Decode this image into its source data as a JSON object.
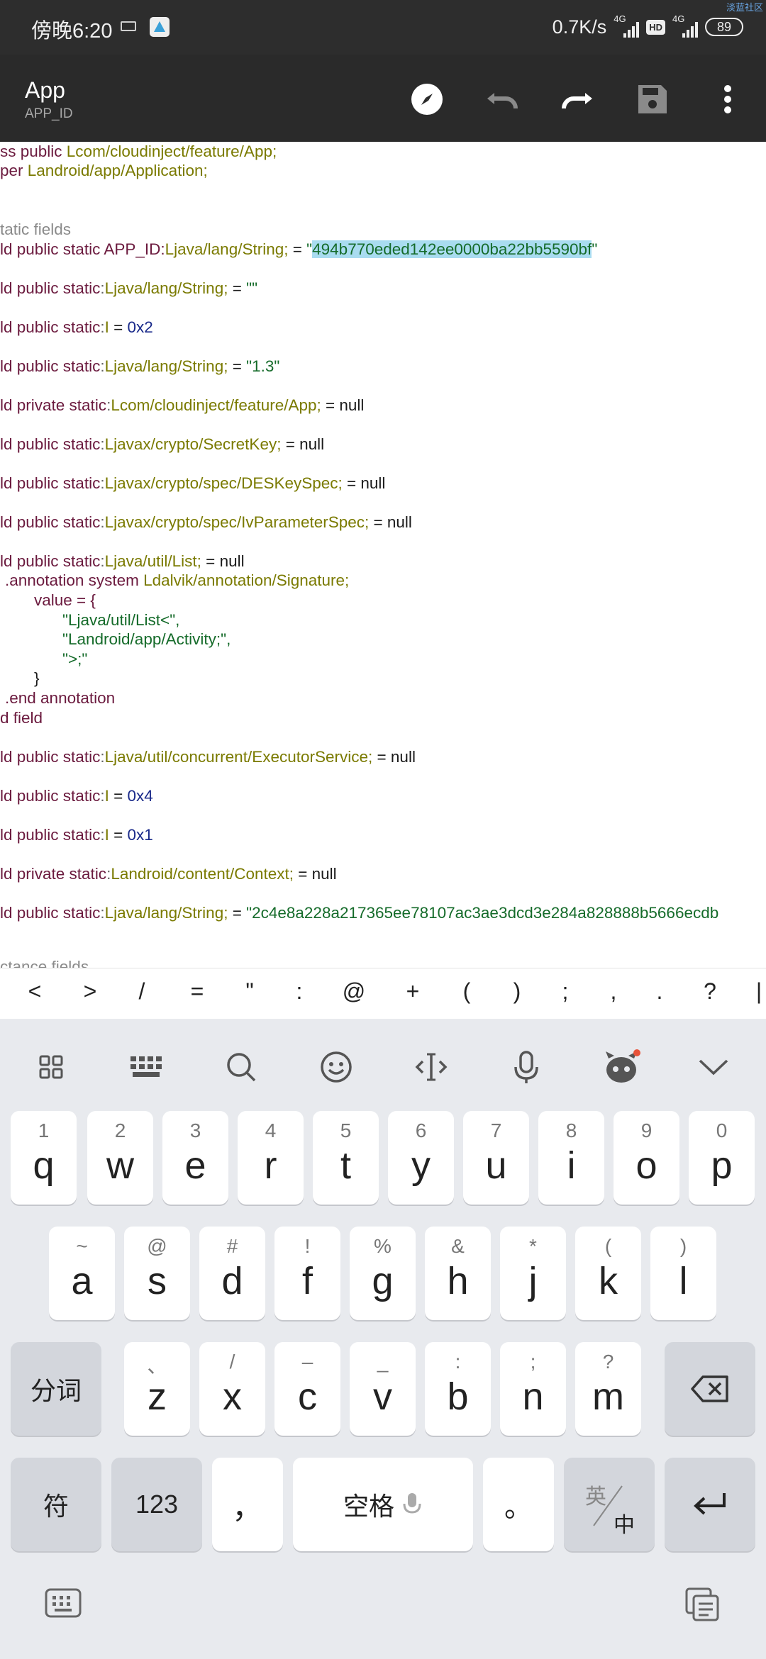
{
  "status_bar": {
    "time": "傍晚6:20",
    "net_speed": "0.7K/s",
    "net_label_1": "4G",
    "net_label_2": "4G",
    "hd": "HD",
    "battery": "89",
    "watermark": "淡蓝社区"
  },
  "app_bar": {
    "title": "App",
    "subtitle": "APP_ID",
    "actions": [
      "compass-icon",
      "undo-icon",
      "redo-icon",
      "save-icon",
      "more-vert-icon"
    ]
  },
  "code": {
    "l01": "ss public ",
    "l01b": "Lcom/cloudinject/feature/App;",
    "l02": "per ",
    "l02b": "Landroid/app/Application;",
    "l03": "tatic fields",
    "l04a": "ld public static APP_ID:",
    "l04b": "Ljava/lang/String;",
    "l04c": " = ",
    "l04d": "\"",
    "l04e": "494b770eded142ee0000ba22bb5590bf",
    "l04f": "\"",
    "l05a": "ld public static",
    "l05b": ":",
    "l05c": "Ljava/lang/String;",
    "l05d": " = ",
    "l05e": "\"\"",
    "l06a": "ld public static",
    "l06b": ":",
    "l06c": "I",
    "l06d": " = ",
    "l06e": "0x2",
    "l07a": "ld public static",
    "l07b": ":",
    "l07c": "Ljava/lang/String;",
    "l07d": " = ",
    "l07e": "\"1.3\"",
    "l08a": "ld private static",
    "l08b": ":",
    "l08c": "Lcom/cloudinject/feature/App;",
    "l08d": " = null",
    "l09a": "ld public static",
    "l09b": ":",
    "l09c": "Ljavax/crypto/SecretKey;",
    "l09d": " = null",
    "l10a": "ld public static",
    "l10b": ":",
    "l10c": "Ljavax/crypto/spec/DESKeySpec;",
    "l10d": " = null",
    "l11a": "ld public static",
    "l11b": ":",
    "l11c": "Ljavax/crypto/spec/IvParameterSpec;",
    "l11d": " = null",
    "l12a": "ld public static",
    "l12b": ":",
    "l12c": "Ljava/util/List;",
    "l12d": " = null",
    "l13a": ".annotation system ",
    "l13b": "Ldalvik/annotation/Signature;",
    "l14": "value = {",
    "l15": "\"Ljava/util/List<\",",
    "l16": "\"Landroid/app/Activity;\",",
    "l17": "\">;\"",
    "l18": "}",
    "l19": ".end annotation",
    "l20": "d field",
    "l21a": "ld public static",
    "l21b": ":",
    "l21c": "Ljava/util/concurrent/ExecutorService;",
    "l21d": " = null",
    "l22a": "ld public static",
    "l22b": ":",
    "l22c": "I",
    "l22d": " = ",
    "l22e": "0x4",
    "l23a": "ld public static",
    "l23b": ":",
    "l23c": "I",
    "l23d": " = ",
    "l23e": "0x1",
    "l24a": "ld private static",
    "l24b": ":",
    "l24c": "Landroid/content/Context;",
    "l24d": " = null",
    "l25a": "ld public static",
    "l25b": ":",
    "l25c": "Ljava/lang/String;",
    "l25d": " = ",
    "l25e": "\"2c4e8a228a217365ee78107ac3ae3dcd3e284a828888b5666ecdb",
    "l26": "ctance fields"
  },
  "symbols": [
    "<",
    ">",
    "/",
    "=",
    "\"",
    ":",
    "@",
    "+",
    "(",
    ")",
    ";",
    ",",
    ".",
    "?",
    "|"
  ],
  "keyboard": {
    "tools": [
      "apps-grid-icon",
      "keyboard-icon",
      "search-icon",
      "emoji-icon",
      "cursor-icon",
      "mic-icon",
      "mascot-icon",
      "collapse-icon"
    ],
    "row1": [
      {
        "hint": "1",
        "key": "q"
      },
      {
        "hint": "2",
        "key": "w"
      },
      {
        "hint": "3",
        "key": "e"
      },
      {
        "hint": "4",
        "key": "r"
      },
      {
        "hint": "5",
        "key": "t"
      },
      {
        "hint": "6",
        "key": "y"
      },
      {
        "hint": "7",
        "key": "u"
      },
      {
        "hint": "8",
        "key": "i"
      },
      {
        "hint": "9",
        "key": "o"
      },
      {
        "hint": "0",
        "key": "p"
      }
    ],
    "row2": [
      {
        "hint": "~",
        "key": "a"
      },
      {
        "hint": "@",
        "key": "s"
      },
      {
        "hint": "#",
        "key": "d"
      },
      {
        "hint": "!",
        "key": "f"
      },
      {
        "hint": "%",
        "key": "g"
      },
      {
        "hint": "&",
        "key": "h"
      },
      {
        "hint": "*",
        "key": "j"
      },
      {
        "hint": "(",
        "key": "k"
      },
      {
        "hint": ")",
        "key": "l"
      }
    ],
    "row3": [
      {
        "hint": "、",
        "key": "z"
      },
      {
        "hint": "/",
        "key": "x"
      },
      {
        "hint": "–",
        "key": "c"
      },
      {
        "hint": "_",
        "key": "v"
      },
      {
        "hint": ":",
        "key": "b"
      },
      {
        "hint": ";",
        "key": "n"
      },
      {
        "hint": "?",
        "key": "m"
      }
    ],
    "fenci": "分词",
    "fu": "符",
    "num123": "123",
    "comma": "，",
    "space": "空格",
    "period": "。",
    "lang_top": "英",
    "lang_bottom": "中"
  }
}
